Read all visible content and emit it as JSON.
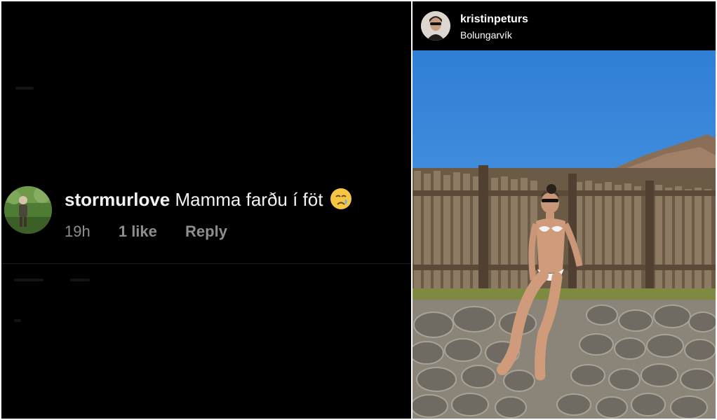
{
  "comment": {
    "username": "stormurlove",
    "text": "Mamma farðu í föt",
    "emoji_icon": "crying-face-icon",
    "time": "19h",
    "likes": "1 like",
    "reply_label": "Reply"
  },
  "post": {
    "username": "kristinpeturs",
    "location": "Bolungarvík"
  },
  "colors": {
    "background": "#000000",
    "text_primary": "#f2f2f2",
    "text_secondary": "#8e8e8e",
    "sky": "#3f8de0"
  }
}
